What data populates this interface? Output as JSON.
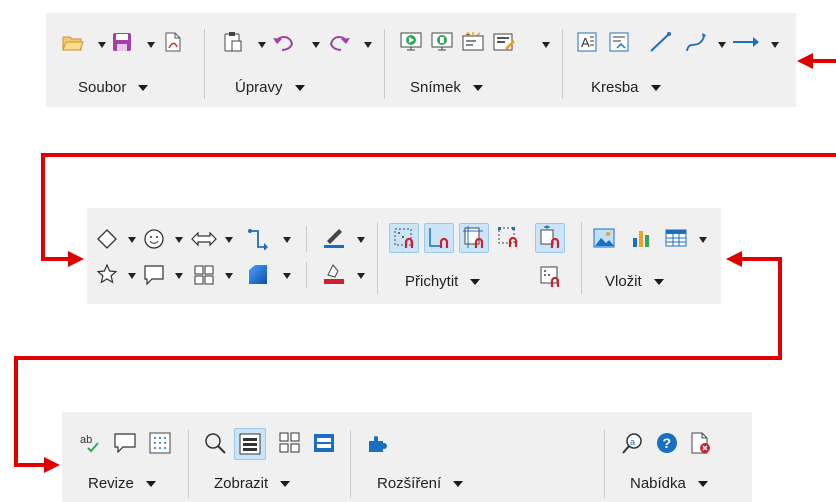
{
  "colors": {
    "arrow": "#e00000",
    "toolbar_bg": "#f0f0f0",
    "active_bg": "#cce4f7"
  },
  "toolbar1": {
    "groups": [
      {
        "label": "Soubor"
      },
      {
        "label": "Úpravy"
      },
      {
        "label": "Snímek"
      },
      {
        "label": "Kresba"
      }
    ],
    "icons": [
      "open-folder-icon",
      "save-icon",
      "export-pdf-icon",
      "paste-icon",
      "undo-icon",
      "redo-icon",
      "start-presentation-icon",
      "start-from-current-icon",
      "slide-transition-icon",
      "slide-layout-icon",
      "text-box-icon",
      "fontwork-icon",
      "line-icon",
      "curve-icon",
      "arrow-line-icon"
    ]
  },
  "toolbar2": {
    "groups": [
      {
        "label": "Přichytit"
      },
      {
        "label": "Vložit"
      }
    ],
    "icons": [
      "basic-shapes-icon",
      "symbol-shapes-icon",
      "block-arrows-icon",
      "connector-icon",
      "line-color-icon",
      "star-icon",
      "callout-icon",
      "flowchart-icon",
      "fill-color-icon",
      "area-style-icon",
      "snap-to-grid-icon",
      "snap-guides-icon",
      "snap-page-margins-icon",
      "snap-object-border-icon",
      "snap-object-points-icon",
      "snap-helplines-icon",
      "insert-image-icon",
      "insert-chart-icon",
      "insert-table-icon"
    ]
  },
  "toolbar3": {
    "groups": [
      {
        "label": "Revize"
      },
      {
        "label": "Zobrazit"
      },
      {
        "label": "Rozšíření"
      },
      {
        "label": "Nabídka"
      }
    ],
    "icons": [
      "spellcheck-icon",
      "comment-icon",
      "grid-icon",
      "zoom-icon",
      "normal-view-icon",
      "slide-sorter-icon",
      "outline-view-icon",
      "extensions-icon",
      "find-replace-icon",
      "help-icon",
      "close-document-icon"
    ]
  }
}
